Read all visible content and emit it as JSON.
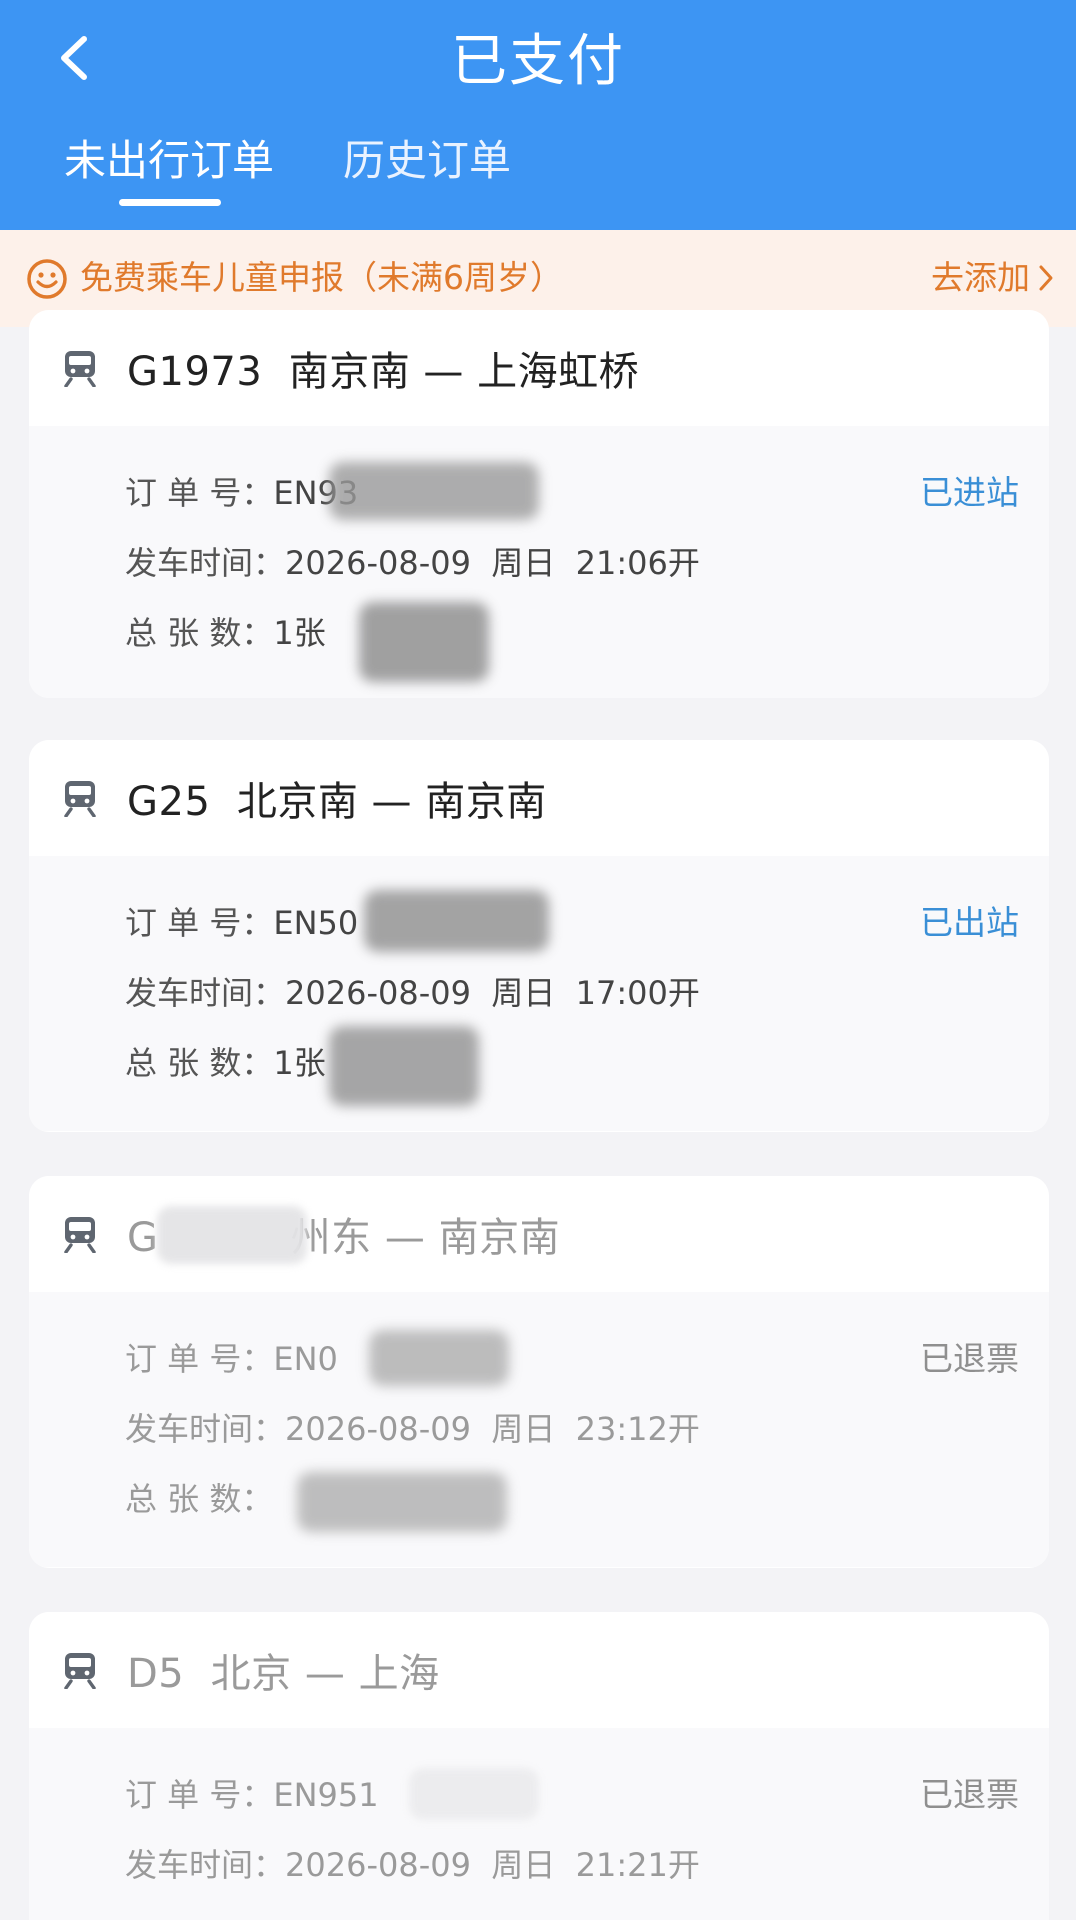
{
  "header": {
    "title": "已支付",
    "tabs": [
      {
        "label": "未出行订单",
        "active": true
      },
      {
        "label": "历史订单",
        "active": false
      }
    ],
    "bg_color": "#3d95f3"
  },
  "banner": {
    "icon": "smile-icon",
    "text": "免费乘车儿童申报（未满6周岁）",
    "action": "去添加",
    "color": "#e07a2c"
  },
  "orders": [
    {
      "train": "G1973",
      "route": "G1973  南京南 — 上海虹桥",
      "order_label": "订 单 号：",
      "order_no": "EN93",
      "depart_label": "发车时间：",
      "depart_time": "2026-08-09  周日  21:06开",
      "count_label": "总 张 数：",
      "count": "1张",
      "status": "已进站",
      "status_color": "#3a8fd6"
    },
    {
      "train": "G25",
      "route": "G25  北京南 — 南京南",
      "order_label": "订 单 号：",
      "order_no": "EN50",
      "depart_label": "发车时间：",
      "depart_time": "2026-08-09  周日  17:00开",
      "count_label": "总 张 数：",
      "count": "1张",
      "status": "已出站",
      "status_color": "#3a8fd6"
    },
    {
      "train": "G",
      "route": "G          州东 — 南京南",
      "order_label": "订 单 号：",
      "order_no": "EN0",
      "depart_label": "发车时间：",
      "depart_time": "2026-08-09  周日  23:12开",
      "count_label": "总 张 数：",
      "count": "",
      "status": "已退票",
      "status_color": "#8f8f8f"
    },
    {
      "train": "D5",
      "route": "D5  北京 — 上海",
      "order_label": "订 单 号：",
      "order_no": "EN951",
      "depart_label": "发车时间：",
      "depart_time": "2026-08-09  周日  21:21开",
      "status": "已退票",
      "status_color": "#8f8f8f"
    }
  ]
}
